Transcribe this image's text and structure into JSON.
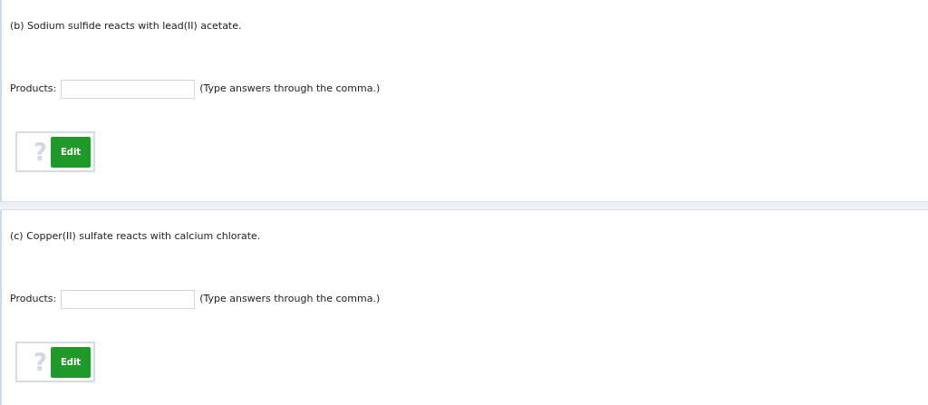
{
  "questions": [
    {
      "prompt": "(b) Sodium sulfide reacts with lead(II) acetate.",
      "field_label": "Products:",
      "hint": "(Type answers through the comma.)",
      "help_glyph": "?",
      "edit_button": "Edit"
    },
    {
      "prompt": "(c) Copper(II) sulfate reacts with calcium chlorate.",
      "field_label": "Products:",
      "hint": "(Type answers through the comma.)",
      "help_glyph": "?",
      "edit_button": "Edit"
    }
  ]
}
